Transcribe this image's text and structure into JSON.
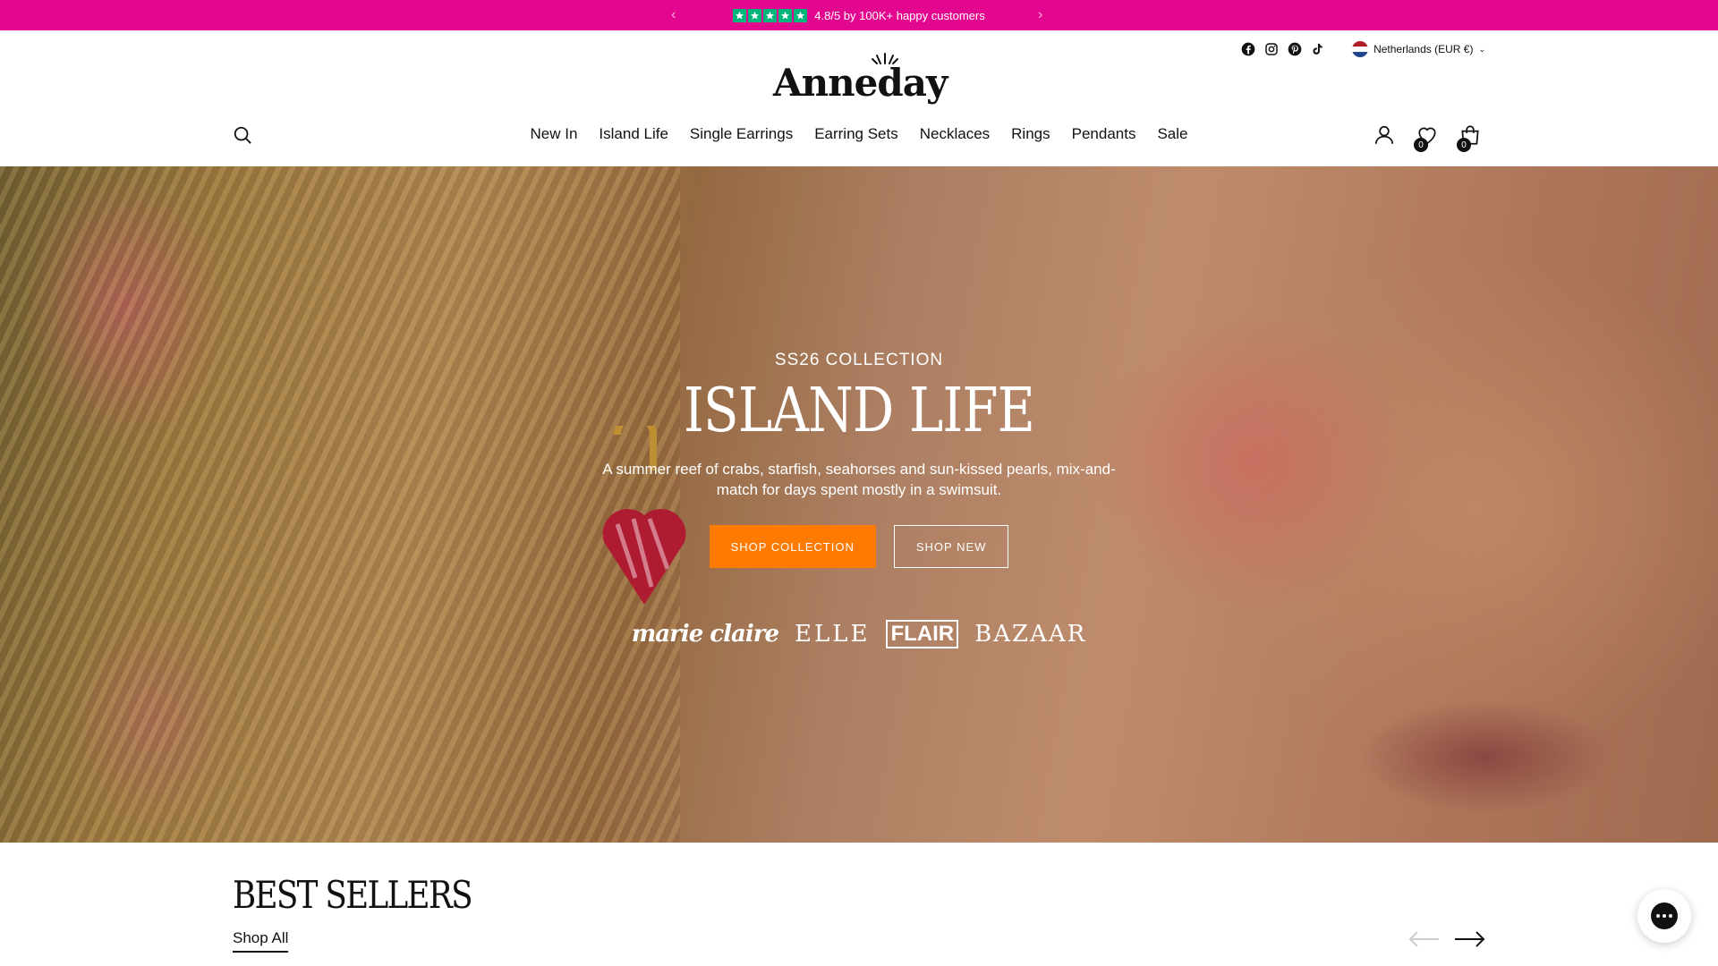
{
  "announcement": {
    "rating_text": "4.8/5 by 100K+ happy customers",
    "prev_icon": "chevron-left-icon",
    "next_icon": "chevron-right-icon",
    "star_color": "#00b67a",
    "bar_color": "#e3068f"
  },
  "header": {
    "logo": "Anneday",
    "country_selector": "Netherlands (EUR €)",
    "social_icons": [
      "facebook-icon",
      "instagram-icon",
      "pinterest-icon",
      "tiktok-icon"
    ],
    "nav": [
      "New In",
      "Island Life",
      "Single Earrings",
      "Earring Sets",
      "Necklaces",
      "Rings",
      "Pendants",
      "Sale"
    ],
    "wishlist_count": "0",
    "cart_count": "0"
  },
  "hero": {
    "eyebrow": "SS26 COLLECTION",
    "title": "ISLAND LIFE",
    "description": "A summer reef of crabs, starfish, seahorses and sun-kissed pearls, mix-and-match for days spent mostly in a swimsuit.",
    "primary_button": "SHOP COLLECTION",
    "secondary_button": "SHOP NEW",
    "primary_color": "#ff7a00",
    "press": [
      "marie claire",
      "ELLE",
      "FLAIR",
      "BAZAAR"
    ]
  },
  "best_sellers": {
    "title": "BEST SELLERS",
    "link": "Shop All"
  }
}
